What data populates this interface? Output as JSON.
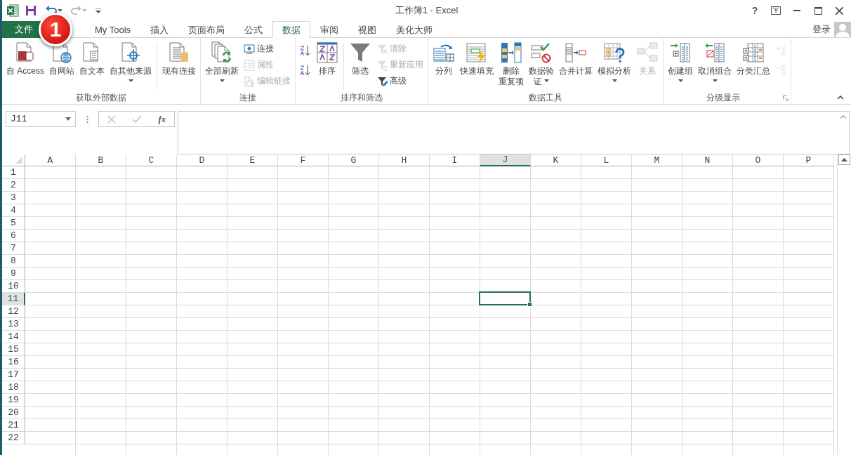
{
  "title_bar": {
    "title": "工作簿1 - Excel",
    "help": "?"
  },
  "tabs": [
    {
      "label": "文件",
      "kind": "file",
      "selected": false
    },
    {
      "label": "My Tools",
      "kind": "tab",
      "selected": false
    },
    {
      "label": "插入",
      "kind": "tab",
      "selected": false
    },
    {
      "label": "页面布局",
      "kind": "tab",
      "selected": false
    },
    {
      "label": "公式",
      "kind": "tab",
      "selected": false
    },
    {
      "label": "数据",
      "kind": "tab",
      "selected": true
    },
    {
      "label": "审阅",
      "kind": "tab",
      "selected": false
    },
    {
      "label": "视图",
      "kind": "tab",
      "selected": false
    },
    {
      "label": "美化大师",
      "kind": "tab",
      "selected": false
    }
  ],
  "sign_in": "登录",
  "callout": "1",
  "ribbon_groups": [
    {
      "label": "获取外部数据",
      "items": [
        {
          "kind": "large",
          "lines": [
            "自 Access"
          ],
          "disabled": false,
          "dropdown": false
        },
        {
          "kind": "large",
          "lines": [
            "自网站"
          ],
          "disabled": false,
          "dropdown": false
        },
        {
          "kind": "large",
          "lines": [
            "自文本"
          ],
          "disabled": false,
          "dropdown": false
        },
        {
          "kind": "large",
          "lines": [
            "自其他来源"
          ],
          "disabled": false,
          "dropdown": true
        },
        {
          "kind": "separator"
        },
        {
          "kind": "large",
          "lines": [
            "现有连接"
          ],
          "disabled": false,
          "dropdown": false
        }
      ]
    },
    {
      "label": "连接",
      "items": [
        {
          "kind": "large",
          "lines": [
            "全部刷新"
          ],
          "disabled": false,
          "dropdown": true
        },
        {
          "kind": "stack",
          "buttons": [
            {
              "label": "连接",
              "disabled": false
            },
            {
              "label": "属性",
              "disabled": true
            },
            {
              "label": "编辑链接",
              "disabled": true
            }
          ]
        }
      ]
    },
    {
      "label": "排序和筛选",
      "items": [
        {
          "kind": "stack",
          "buttons": [
            {
              "disabled": false
            },
            {
              "disabled": false
            }
          ]
        },
        {
          "kind": "large",
          "lines": [
            "排序"
          ],
          "disabled": false,
          "dropdown": false
        },
        {
          "kind": "separator"
        },
        {
          "kind": "large",
          "lines": [
            "筛选"
          ],
          "disabled": false,
          "dropdown": false
        },
        {
          "kind": "stack",
          "buttons": [
            {
              "label": "清除",
              "disabled": true
            },
            {
              "label": "重新应用",
              "disabled": true
            },
            {
              "label": "高级",
              "disabled": false
            }
          ]
        }
      ]
    },
    {
      "label": "数据工具",
      "items": [
        {
          "kind": "large",
          "lines": [
            "分列"
          ],
          "disabled": false,
          "dropdown": false
        },
        {
          "kind": "large",
          "lines": [
            "快速填充"
          ],
          "disabled": false,
          "dropdown": false
        },
        {
          "kind": "large",
          "lines": [
            "删除",
            "重复项"
          ],
          "disabled": false,
          "dropdown": false
        },
        {
          "kind": "large",
          "lines": [
            "数据验",
            "证"
          ],
          "disabled": false,
          "dropdown": true
        },
        {
          "kind": "large",
          "lines": [
            "合并计算"
          ],
          "disabled": false,
          "dropdown": false
        },
        {
          "kind": "large",
          "lines": [
            "模拟分析"
          ],
          "disabled": false,
          "dropdown": true
        },
        {
          "kind": "large",
          "lines": [
            "关系"
          ],
          "disabled": true,
          "dropdown": false
        }
      ]
    },
    {
      "label": "分级显示",
      "launcher": true,
      "items": [
        {
          "kind": "large",
          "lines": [
            "创建组"
          ],
          "disabled": false,
          "dropdown": true
        },
        {
          "kind": "large",
          "lines": [
            "取消组合"
          ],
          "disabled": false,
          "dropdown": true
        },
        {
          "kind": "large",
          "lines": [
            "分类汇总"
          ],
          "disabled": false,
          "dropdown": false
        },
        {
          "kind": "stack",
          "buttons": [
            {
              "disabled": true
            },
            {
              "disabled": true
            }
          ]
        }
      ]
    }
  ],
  "formula_bar": {
    "name_box": "J11",
    "function_button": "fx"
  },
  "grid": {
    "columns": [
      {
        "label": "A",
        "selected": false
      },
      {
        "label": "B",
        "selected": false
      },
      {
        "label": "C",
        "selected": false
      },
      {
        "label": "D",
        "selected": false
      },
      {
        "label": "E",
        "selected": false
      },
      {
        "label": "F",
        "selected": false
      },
      {
        "label": "G",
        "selected": false
      },
      {
        "label": "H",
        "selected": false
      },
      {
        "label": "I",
        "selected": false
      },
      {
        "label": "J",
        "selected": true
      },
      {
        "label": "K",
        "selected": false
      },
      {
        "label": "L",
        "selected": false
      },
      {
        "label": "M",
        "selected": false
      },
      {
        "label": "N",
        "selected": false
      },
      {
        "label": "O",
        "selected": false
      },
      {
        "label": "P",
        "selected": false
      }
    ],
    "rows": [
      {
        "label": "1",
        "selected": false
      },
      {
        "label": "2",
        "selected": false
      },
      {
        "label": "3",
        "selected": false
      },
      {
        "label": "4",
        "selected": false
      },
      {
        "label": "5",
        "selected": false
      },
      {
        "label": "6",
        "selected": false
      },
      {
        "label": "7",
        "selected": false
      },
      {
        "label": "8",
        "selected": false
      },
      {
        "label": "9",
        "selected": false
      },
      {
        "label": "10",
        "selected": false
      },
      {
        "label": "11",
        "selected": true
      },
      {
        "label": "12",
        "selected": false
      },
      {
        "label": "13",
        "selected": false
      },
      {
        "label": "14",
        "selected": false
      },
      {
        "label": "15",
        "selected": false
      },
      {
        "label": "16",
        "selected": false
      },
      {
        "label": "17",
        "selected": false
      },
      {
        "label": "18",
        "selected": false
      },
      {
        "label": "19",
        "selected": false
      },
      {
        "label": "20",
        "selected": false
      },
      {
        "label": "21",
        "selected": false
      },
      {
        "label": "22",
        "selected": false
      }
    ]
  }
}
